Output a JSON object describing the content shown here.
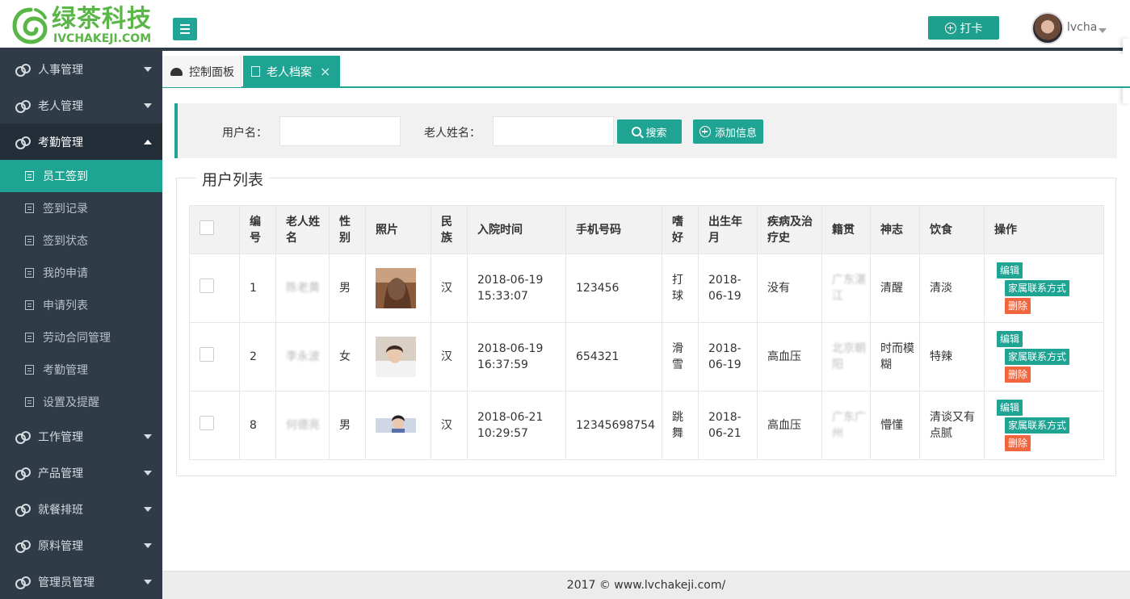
{
  "brand": {
    "name_cn": "绿茶科技",
    "name_en": "IVCHAKEJI.COM",
    "color": "#5ab647"
  },
  "header": {
    "punch_label": "打卡",
    "username": "lvcha"
  },
  "sidebar": {
    "groups": [
      {
        "label": "人事管理"
      },
      {
        "label": "老人管理"
      },
      {
        "label": "考勤管理",
        "open": true,
        "items": [
          {
            "label": "员工签到",
            "active": true
          },
          {
            "label": "签到记录"
          },
          {
            "label": "签到状态"
          },
          {
            "label": "我的申请"
          },
          {
            "label": "申请列表"
          },
          {
            "label": "劳动合同管理"
          },
          {
            "label": "考勤管理"
          },
          {
            "label": "设置及提醒"
          }
        ]
      },
      {
        "label": "工作管理"
      },
      {
        "label": "产品管理"
      },
      {
        "label": "就餐排班"
      },
      {
        "label": "原料管理"
      },
      {
        "label": "管理员管理"
      }
    ]
  },
  "tabs": [
    {
      "label": "控制面板"
    },
    {
      "label": "老人档案",
      "active": true,
      "close": "×"
    }
  ],
  "search": {
    "username_label": "用户名：",
    "elder_name_label": "老人姓名：",
    "search_button": "搜索",
    "add_button": "添加信息"
  },
  "list": {
    "title": "用户列表",
    "columns": [
      "",
      "编号",
      "老人姓名",
      "性别",
      "照片",
      "民族",
      "入院时间",
      "手机号码",
      "嗜好",
      "出生年月",
      "疾病及治疗史",
      "籍贯",
      "神志",
      "饮食",
      "操作"
    ],
    "rows": [
      {
        "id": "1",
        "name": "陈老黄",
        "gender": "男",
        "ethnic": "汉",
        "admit_date": "2018-06-19",
        "admit_time": "15:33:07",
        "phone": "123456",
        "hobby": "打球",
        "birth": "2018-06-19",
        "disease": "没有",
        "native": "广东湛江",
        "mind": "清醒",
        "diet": "清淡"
      },
      {
        "id": "2",
        "name": "李永波",
        "gender": "女",
        "ethnic": "汉",
        "admit_date": "2018-06-19",
        "admit_time": "16:37:59",
        "phone": "654321",
        "hobby": "滑雪",
        "birth": "2018-06-19",
        "disease": "高血压",
        "native": "北京朝阳",
        "mind": "时而模糊",
        "diet": "特辣"
      },
      {
        "id": "8",
        "name": "何德亮",
        "gender": "男",
        "ethnic": "汉",
        "admit_date": "2018-06-21",
        "admit_time": "10:29:57",
        "phone": "12345698754",
        "hobby": "跳舞",
        "birth": "2018-06-21",
        "disease": "高血压",
        "native": "广东广州",
        "mind": "懵懂",
        "diet": "清谈又有点腻"
      }
    ],
    "actions": {
      "edit": "编辑",
      "contact": "家属联系方式",
      "delete": "删除"
    }
  },
  "footer": {
    "text": "2017 ©  www.lvchakeji.com/"
  },
  "colors": {
    "accent": "#1fa392",
    "sidebar": "#2f3b47",
    "danger": "#f0663f"
  }
}
